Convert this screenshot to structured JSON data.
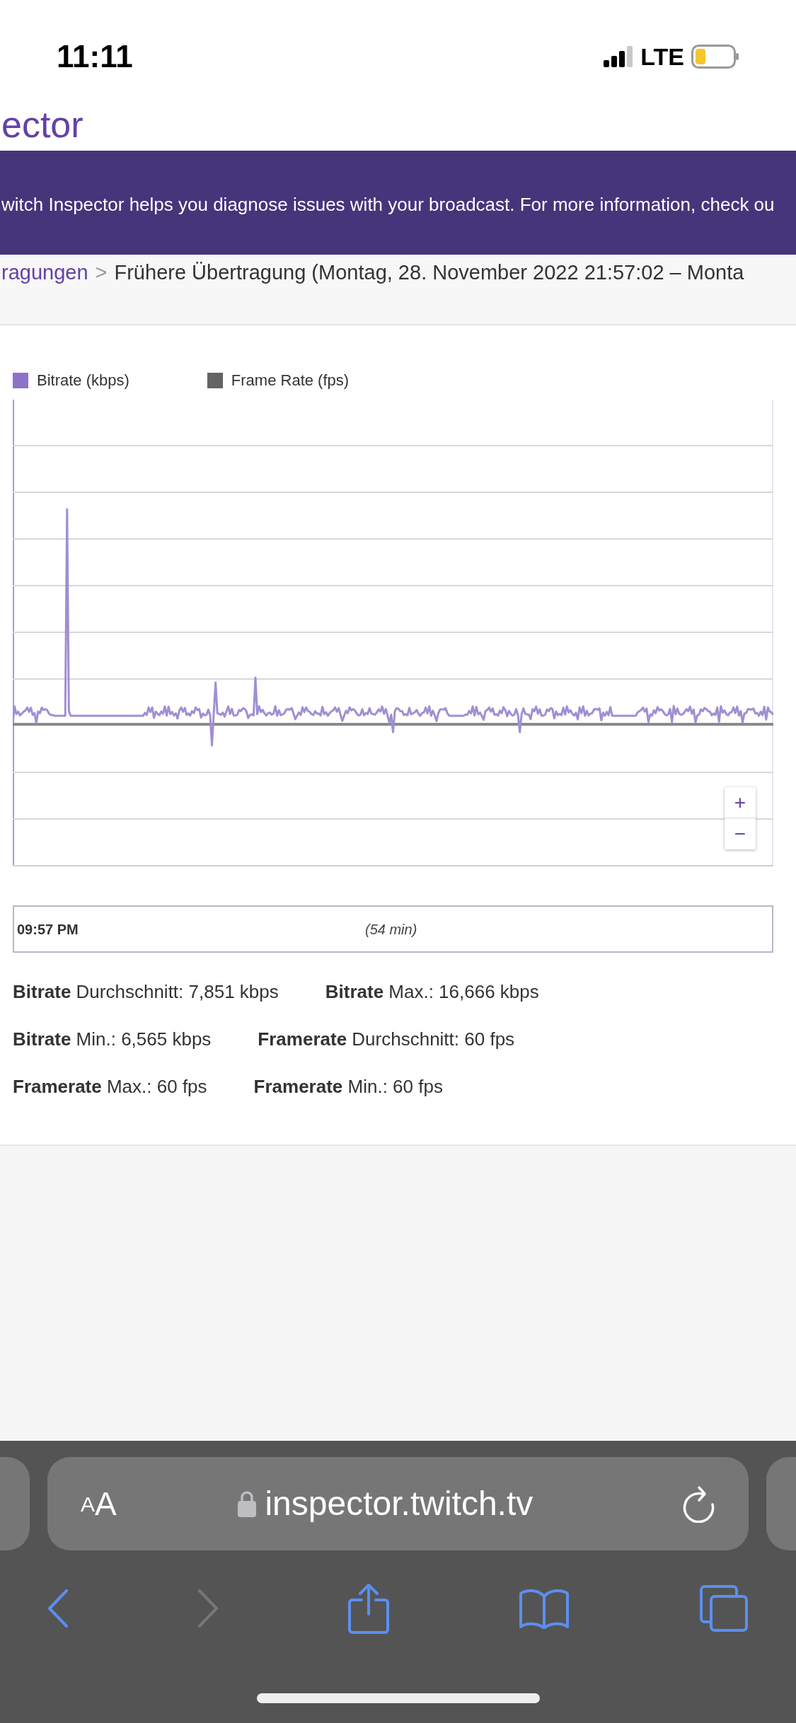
{
  "status_bar": {
    "time": "11:11",
    "network": "LTE"
  },
  "header": {
    "logo_text": "ector"
  },
  "banner": {
    "text": "witch Inspector helps you diagnose issues with your broadcast. For more information, check ou"
  },
  "breadcrumb": {
    "link": "ragungen",
    "separator": ">",
    "current": "Frühere Übertragung (Montag, 28. November 2022 21:57:02 – Monta"
  },
  "chart": {
    "legend": [
      {
        "label": "Bitrate (kbps)",
        "color": "#8e72c9"
      },
      {
        "label": "Frame Rate (fps)",
        "color": "#646464"
      }
    ],
    "zoom_in": "+",
    "zoom_out": "−"
  },
  "timeline": {
    "start": "09:57 PM",
    "duration": "(54 min)"
  },
  "stats": [
    "**Bitrate** Durchschnitt: 7,851 kbps",
    "**Bitrate** Max.: 16,666 kbps",
    "**Bitrate** Min.: 6,565 kbps",
    "**Framerate** Durchschnitt: 60 fps",
    "**Framerate** Max.: 60 fps",
    "**Framerate** Min.: 60 fps"
  ],
  "browser": {
    "text_size_small": "A",
    "text_size_large": "A",
    "url": "inspector.twitch.tv"
  }
}
